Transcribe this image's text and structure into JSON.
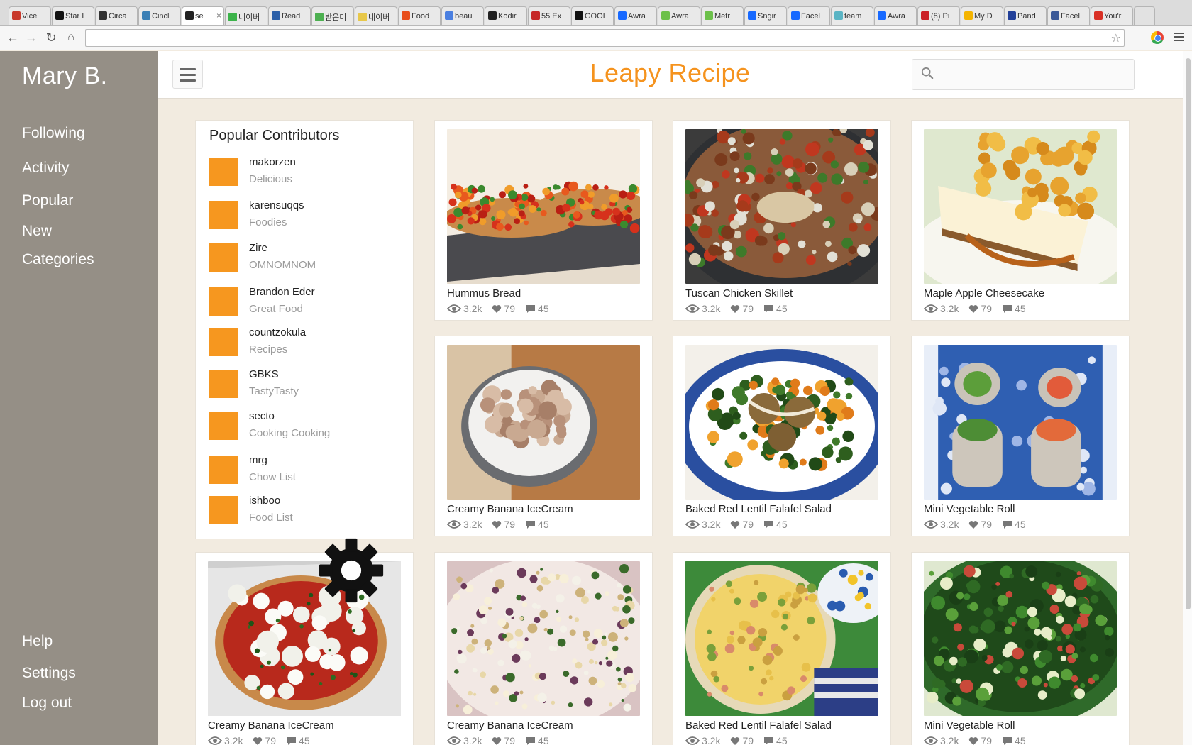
{
  "browser": {
    "tabs": [
      {
        "label": "Vice",
        "color": "#c8392b"
      },
      {
        "label": "Star I",
        "color": "#111111"
      },
      {
        "label": "Circa",
        "color": "#333333"
      },
      {
        "label": "Cincl",
        "color": "#3a7fb5"
      },
      {
        "label": "se",
        "color": "#222222",
        "active": true
      },
      {
        "label": "네이버",
        "color": "#3cb34a"
      },
      {
        "label": "Read",
        "color": "#2b5fa8"
      },
      {
        "label": "받은미",
        "color": "#4caf50"
      },
      {
        "label": "네이버",
        "color": "#e8c84a"
      },
      {
        "label": "Food",
        "color": "#e84e1b"
      },
      {
        "label": "beau",
        "color": "#4a7fe0"
      },
      {
        "label": "Kodir",
        "color": "#222222"
      },
      {
        "label": "55 Ex",
        "color": "#c62828"
      },
      {
        "label": "GOOI",
        "color": "#111111"
      },
      {
        "label": "Awra",
        "color": "#1769ff"
      },
      {
        "label": "Awra",
        "color": "#6cc04a"
      },
      {
        "label": "Metr",
        "color": "#6cc04a"
      },
      {
        "label": "Sngir",
        "color": "#1769ff"
      },
      {
        "label": "Facel",
        "color": "#1769ff"
      },
      {
        "label": "team",
        "color": "#5ab4c4"
      },
      {
        "label": "Awra",
        "color": "#1769ff"
      },
      {
        "label": "(8) Pi",
        "color": "#cb2027"
      },
      {
        "label": "My D",
        "color": "#f4b400"
      },
      {
        "label": "Pand",
        "color": "#224099"
      },
      {
        "label": "Facel",
        "color": "#3b5998"
      },
      {
        "label": "You'r",
        "color": "#d93025"
      }
    ]
  },
  "user": {
    "name": "Mary B."
  },
  "nav": {
    "following": "Following",
    "activity": "Activity",
    "popular": "Popular",
    "new": "New",
    "categories": "Categories",
    "help": "Help",
    "settings": "Settings",
    "logout": "Log out"
  },
  "header": {
    "title": "Leapy Recipe",
    "search_placeholder": ""
  },
  "contributors": {
    "title": "Popular Contributors",
    "avatar_color": "#f6971f",
    "items": [
      {
        "name": "makorzen",
        "board": "Delicious"
      },
      {
        "name": "karensuqqs",
        "board": "Foodies"
      },
      {
        "name": "Zire",
        "board": "OMNOMNOM"
      },
      {
        "name": "Brandon Eder",
        "board": "Great Food"
      },
      {
        "name": "countzokula",
        "board": "Recipes"
      },
      {
        "name": "GBKS",
        "board": "TastyTasty"
      },
      {
        "name": "secto",
        "board": "Cooking Cooking"
      },
      {
        "name": "mrg",
        "board": "Chow List"
      },
      {
        "name": "ishboo",
        "board": "Food List"
      }
    ]
  },
  "recipes": [
    {
      "title": "Hummus Bread",
      "views": "3.2k",
      "likes": "79",
      "comments": "45",
      "photo": "bruschetta"
    },
    {
      "title": "Tuscan Chicken Skillet",
      "views": "3.2k",
      "likes": "79",
      "comments": "45",
      "photo": "skillet"
    },
    {
      "title": "Maple Apple Cheesecake",
      "views": "3.2k",
      "likes": "79",
      "comments": "45",
      "photo": "cheesecake"
    },
    {
      "title": "Creamy Banana IceCream",
      "views": "3.2k",
      "likes": "79",
      "comments": "45",
      "photo": "icecream-bowl"
    },
    {
      "title": "Baked Red Lentil Falafel Salad",
      "views": "3.2k",
      "likes": "79",
      "comments": "45",
      "photo": "falafel-salad"
    },
    {
      "title": "Mini Vegetable Roll",
      "views": "3.2k",
      "likes": "79",
      "comments": "45",
      "photo": "vegetable-rolls"
    },
    {
      "title": "Creamy Banana IceCream",
      "views": "3.2k",
      "likes": "79",
      "comments": "45",
      "photo": "pizza"
    },
    {
      "title": "Creamy Banana IceCream",
      "views": "3.2k",
      "likes": "79",
      "comments": "45",
      "photo": "pasta"
    },
    {
      "title": "Baked Red Lentil Falafel Salad",
      "views": "3.2k",
      "likes": "79",
      "comments": "45",
      "photo": "quiche"
    },
    {
      "title": "Mini Vegetable Roll",
      "views": "3.2k",
      "likes": "79",
      "comments": "45",
      "photo": "kale-salad"
    }
  ],
  "colors": {
    "accent": "#f5931e",
    "sidebar": "#958f86",
    "background": "#f2ebe0"
  }
}
